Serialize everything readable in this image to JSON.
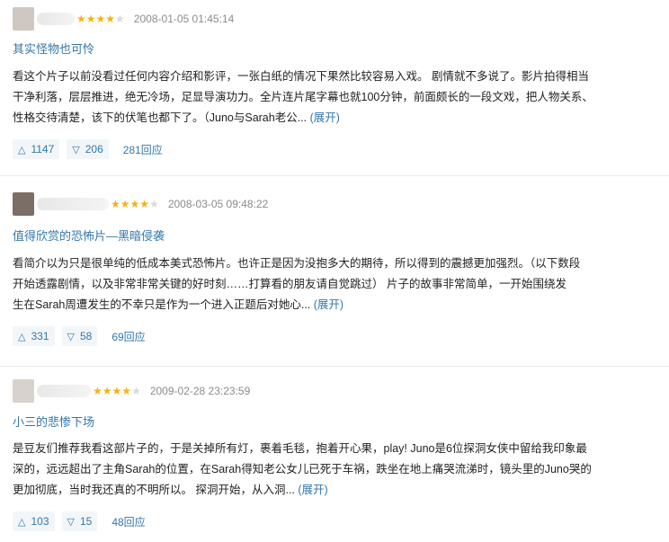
{
  "reviews": [
    {
      "rating": 4,
      "time": "2008-01-05 01:45:14",
      "title": "其实怪物也可怜",
      "content_lines": [
        "看这个片子以前没看过任何内容介绍和影评，一张白纸的情况下果然比较容易入戏。 剧情就不多说了。影片拍得相当",
        "干净利落，层层推进，绝无冷场，足显导演功力。全片连片尾字幕也就100分钟，前面颇长的一段文戏，把人物关系、",
        "性格交待清楚，该下的伏笔也都下了。（Juno与Sarah老公..."
      ],
      "expand_label": "(展开)",
      "up_count": "1147",
      "down_count": "206",
      "replies_label": "281回应"
    },
    {
      "rating": 4,
      "time": "2008-03-05 09:48:22",
      "title": "值得欣赏的恐怖片—黑暗侵袭",
      "content_lines": [
        "看简介以为只是很单纯的低成本美式恐怖片。也许正是因为没抱多大的期待，所以得到的震撼更加强烈。（以下数段",
        "开始透露剧情，以及非常非常关键的好时刻……打算看的朋友请自觉跳过）        片子的故事非常简单，一开始围绕发",
        "生在Sarah周遭发生的不幸只是作为一个进入正题后对她心..."
      ],
      "expand_label": "(展开)",
      "up_count": "331",
      "down_count": "58",
      "replies_label": "69回应"
    },
    {
      "rating": 4,
      "time": "2009-02-28 23:23:59",
      "title": "小三的悲惨下场",
      "content_lines": [
        "是豆友们推荐我看这部片子的，于是关掉所有灯，裹着毛毯，抱着开心果，play! Juno是6位探洞女侠中留给我印象最",
        "深的，远远超出了主角Sarah的位置，在Sarah得知老公女儿已死于车祸，跌坐在地上痛哭流涕时，镜头里的Juno哭的",
        "更加彻底，当时我还真的不明所以。 探洞开始，从入洞..."
      ],
      "expand_label": "(展开)",
      "up_count": "103",
      "down_count": "15",
      "replies_label": "48回应"
    }
  ],
  "icons": {
    "upvote": "triangle-up-icon",
    "downvote": "triangle-down-icon",
    "star": "star-icon"
  },
  "colors": {
    "link": "#3377aa",
    "star": "#f7b20f",
    "meta": "#8b8b8b"
  }
}
